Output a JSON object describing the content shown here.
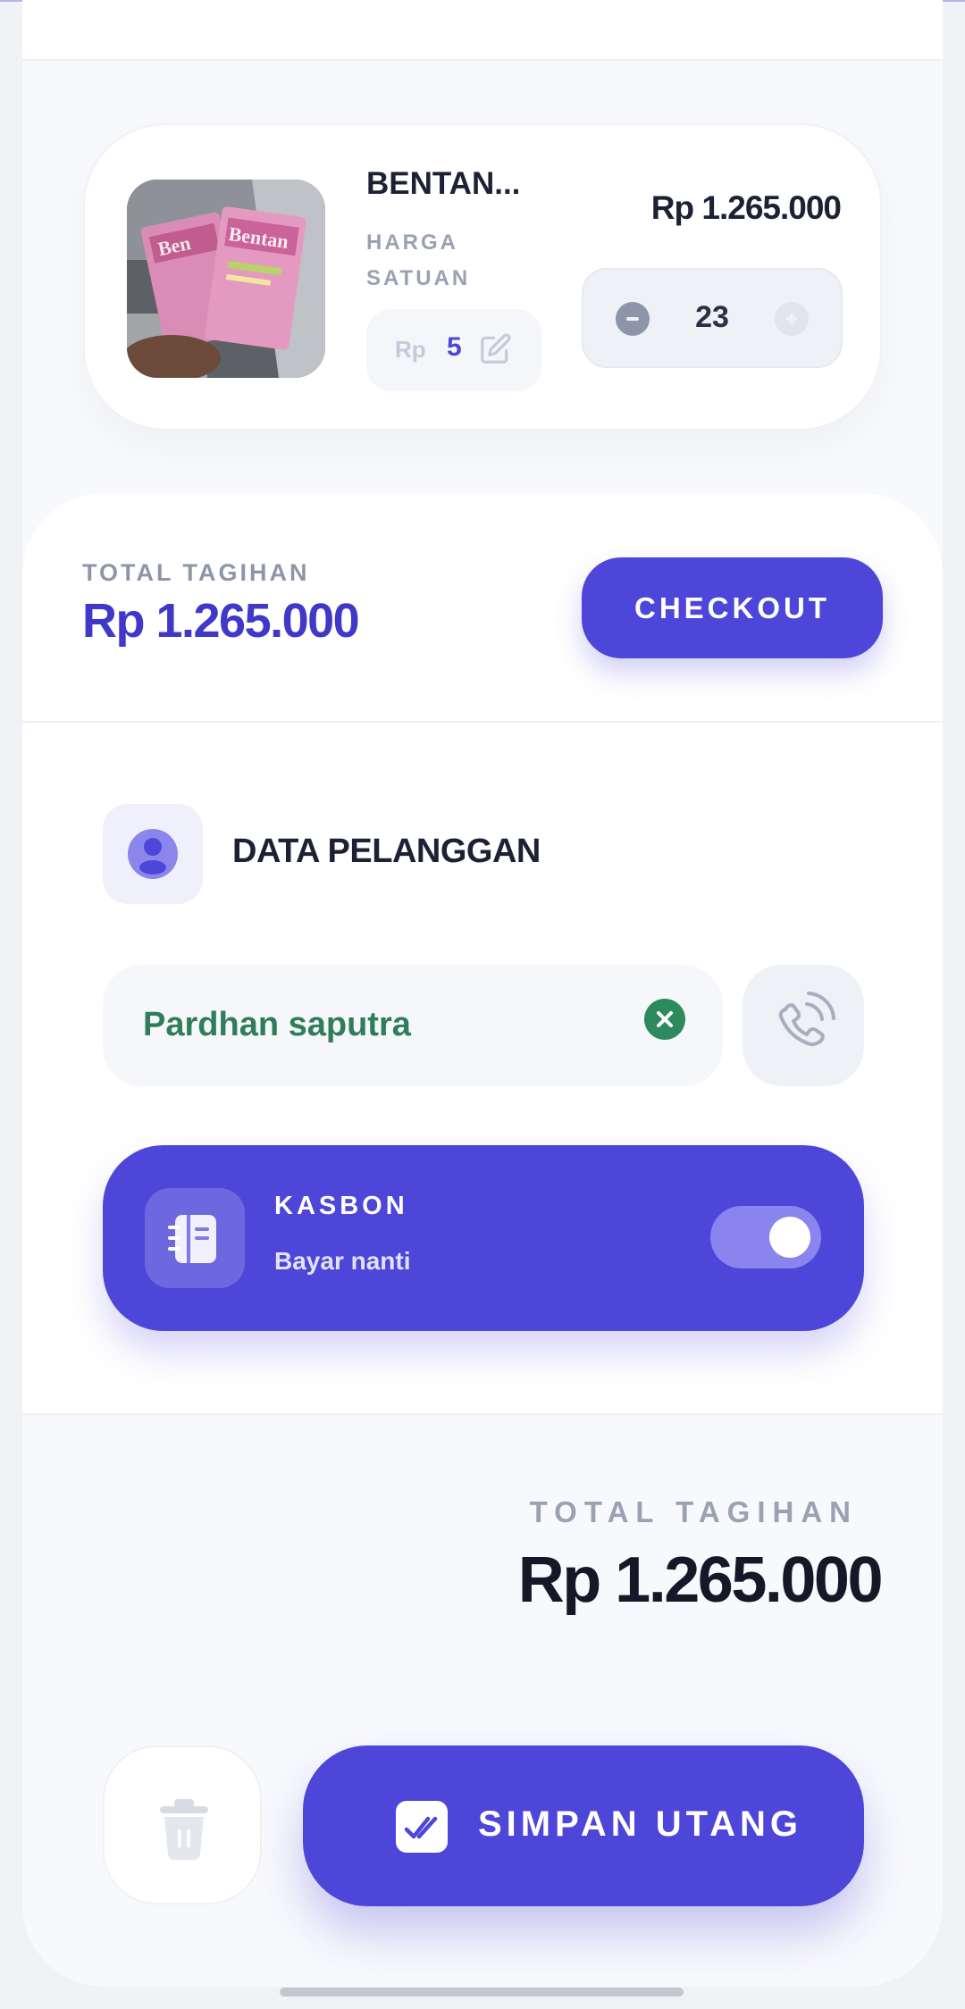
{
  "product": {
    "name": "BENTAN...",
    "unit_price_label": "HARGA SATUAN",
    "currency": "Rp",
    "unit_price": "5",
    "line_total": "Rp 1.265.000",
    "quantity": "23"
  },
  "summary": {
    "label": "TOTAL TAGIHAN",
    "value": "Rp 1.265.000",
    "checkout_label": "CHECKOUT"
  },
  "customer": {
    "title": "DATA PELANGGAN",
    "name": "Pardhan saputra"
  },
  "kasbon": {
    "title": "KASBON",
    "subtitle": "Bayar nanti",
    "enabled": true
  },
  "footer": {
    "total_label": "TOTAL TAGIHAN",
    "total_value": "Rp 1.265.000",
    "save_label": "SIMPAN UTANG"
  },
  "colors": {
    "accent": "#4d46d9",
    "customer_name": "#2f7d5b",
    "clear_button": "#2d8a5c"
  },
  "icons": [
    "edit-icon",
    "minus-icon",
    "plus-icon",
    "user-icon",
    "clear-icon",
    "phone-icon",
    "notebook-icon",
    "trash-icon",
    "check-icon"
  ]
}
